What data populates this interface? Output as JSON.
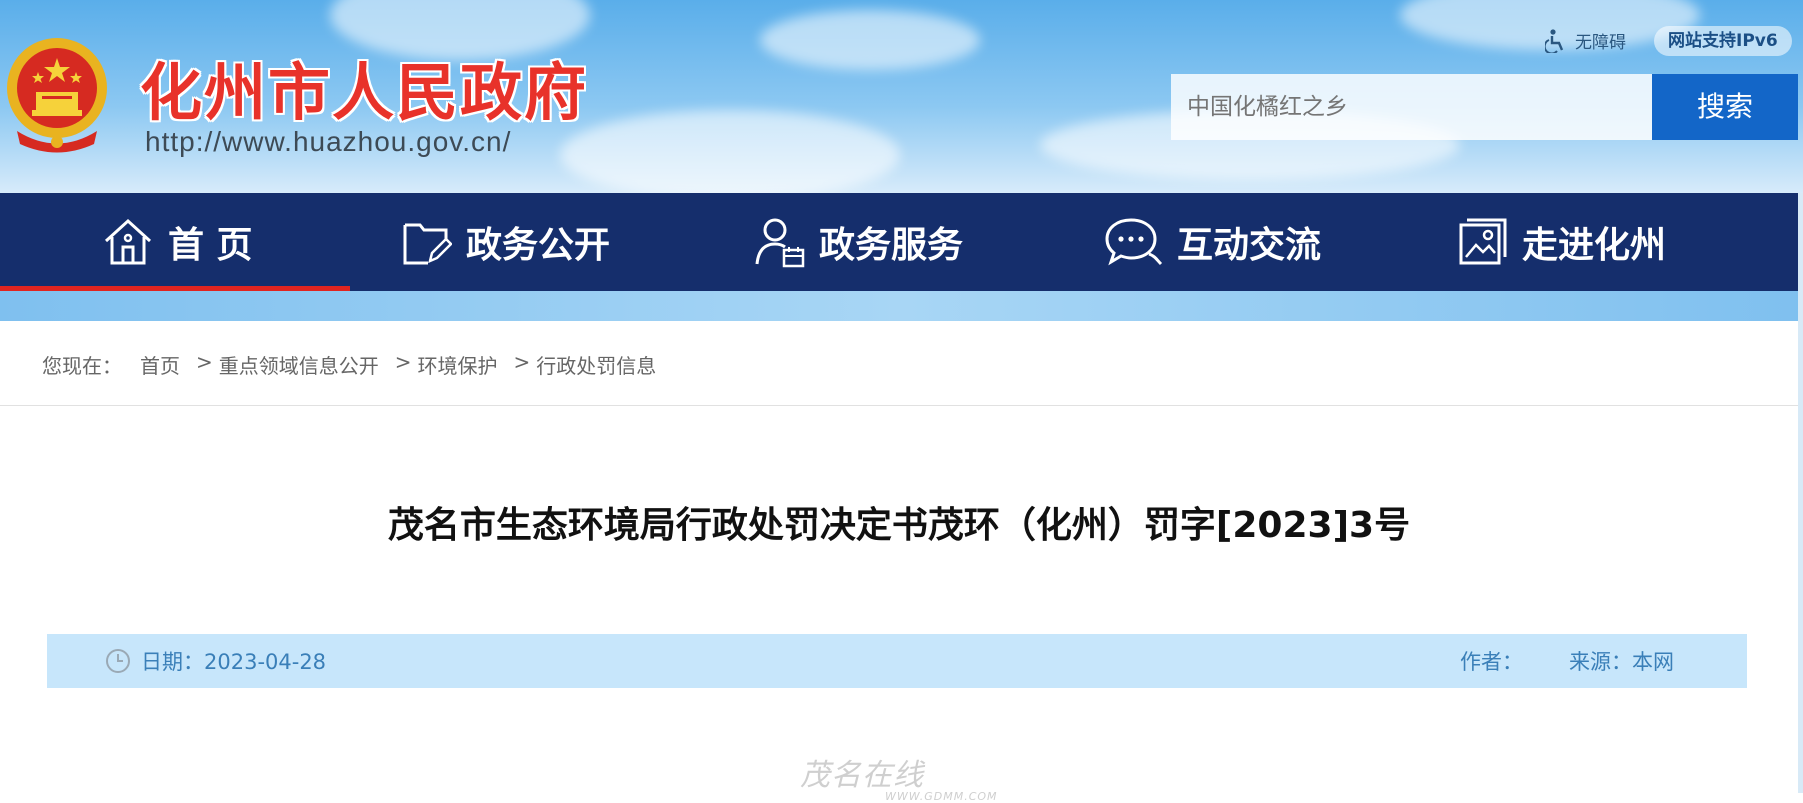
{
  "header": {
    "site_title": "化州市人民政府",
    "site_url": "http://www.huazhou.gov.cn/",
    "accessibility_label": "无障碍",
    "ipv6_label": "网站支持IPv6",
    "search_placeholder": "中国化橘红之乡",
    "search_button": "搜索"
  },
  "nav": {
    "items": [
      {
        "label": "首 页",
        "icon": "home-icon",
        "active": true
      },
      {
        "label": "政务公开",
        "icon": "folder-edit-icon"
      },
      {
        "label": "政务服务",
        "icon": "user-calendar-icon"
      },
      {
        "label": "互动交流",
        "icon": "chat-icon"
      },
      {
        "label": "走进化州",
        "icon": "picture-icon"
      }
    ]
  },
  "breadcrumb": {
    "prefix": "您现在：",
    "items": [
      "首页",
      "重点领域信息公开",
      "环境保护",
      "行政处罚信息"
    ],
    "separator": ">"
  },
  "article": {
    "title": "茂名市生态环境局行政处罚决定书茂环（化州）罚字[2023]3号",
    "date_label": "日期：2023-04-28",
    "author_label": "作者：",
    "source_label": "来源：",
    "source_value": "本网"
  },
  "watermark": {
    "text": "茂名在线",
    "sub": "WWW.GDMM.COM"
  },
  "colors": {
    "nav_bg": "#152e6c",
    "accent_red": "#e0241f",
    "search_button": "#1366c8",
    "meta_bar": "#c7e6fb"
  }
}
